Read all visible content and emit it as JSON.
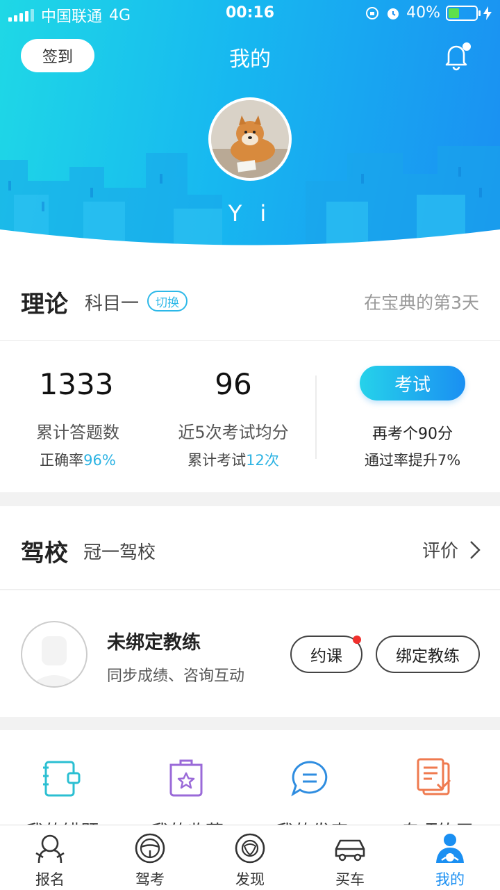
{
  "status_bar": {
    "carrier": "中国联通",
    "network": "4G",
    "time": "00:16",
    "battery_text": "40%",
    "battery_level": 0.4
  },
  "header": {
    "checkin_label": "签到",
    "title": "我的",
    "username": "Y i",
    "has_notification": true
  },
  "theory": {
    "title": "理论",
    "subject": "科目一",
    "switch_label": "切换",
    "days_text": "在宝典的第3天",
    "answered_count": "1333",
    "answered_label": "累计答题数",
    "accuracy_prefix": "正确率",
    "accuracy_value": "96%",
    "avg_score": "96",
    "avg_label": "近5次考试均分",
    "exam_count_prefix": "累计考试",
    "exam_count_value": "12次",
    "exam_button": "考试",
    "exam_goal": "再考个90分",
    "exam_gain": "通过率提升7%"
  },
  "school": {
    "title": "驾校",
    "name": "冠一驾校",
    "rate_label": "评价"
  },
  "coach": {
    "name": "未绑定教练",
    "desc": "同步成绩、咨询互动",
    "book_label": "约课",
    "bind_label": "绑定教练"
  },
  "tools": [
    {
      "label": "我的错题",
      "icon": "notebook-icon"
    },
    {
      "label": "我的收藏",
      "icon": "star-folder-icon"
    },
    {
      "label": "我的发表",
      "icon": "chat-bubble-icon"
    },
    {
      "label": "专项练习",
      "icon": "document-check-icon"
    }
  ],
  "tabs": [
    {
      "label": "报名",
      "icon": "signup-icon"
    },
    {
      "label": "驾考",
      "icon": "steering-wheel-icon"
    },
    {
      "label": "发现",
      "icon": "discover-icon"
    },
    {
      "label": "买车",
      "icon": "car-icon"
    },
    {
      "label": "我的",
      "icon": "profile-icon",
      "active": true
    }
  ],
  "colors": {
    "accent": "#1a8ff2",
    "accent_light": "#2cb3e3",
    "badge": "#f0302d"
  }
}
